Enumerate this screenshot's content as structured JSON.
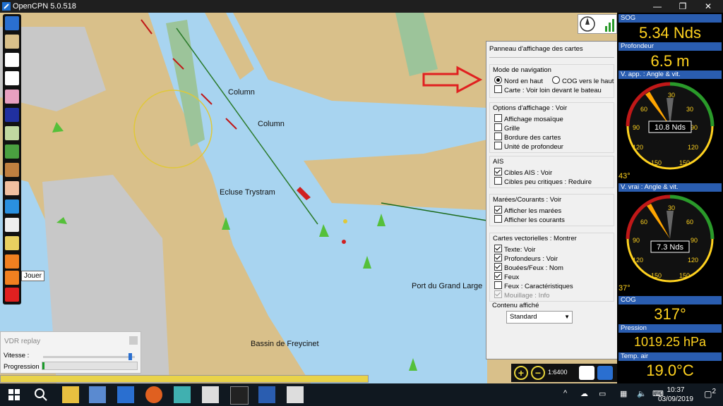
{
  "window": {
    "title": "OpenCPN 5.0.518",
    "minimize": "—",
    "maximize": "❐",
    "close": "✕"
  },
  "map": {
    "labels": {
      "column1": "Column",
      "column2": "Column",
      "ecluse": "Ecluse Trystram",
      "port": "Port du Grand Large",
      "bassin": "Bassin de Freycinet"
    }
  },
  "toolbar": {
    "tooltip": "Jouer",
    "icons": [
      "menu-icon",
      "settings-icon",
      "route-icon",
      "track-icon",
      "mark-icon",
      "chart-icon",
      "tides-icon",
      "grid-icon",
      "zoom-icon",
      "info-icon",
      "rocket-icon",
      "doc-icon",
      "pencil-icon",
      "record-icon",
      "play-icon",
      "lifebuoy-icon"
    ]
  },
  "panel": {
    "title": "Panneau d'affichage des cartes",
    "nav_mode": {
      "heading": "Mode de navigation",
      "north_up": "Nord en haut",
      "cog_up": "COG vers le haut",
      "look_ahead": "Carte : Voir loin devant le bateau"
    },
    "display": {
      "heading": "Options d'affichage : Voir",
      "mosaic": "Affichage mosaïque",
      "grid": "Grille",
      "borders": "Bordure des cartes",
      "depth_unit": "Unité de profondeur"
    },
    "ais": {
      "heading": "AIS",
      "targets": "Cibles AIS : Voir",
      "low_critical": "Cibles peu critiques : Reduire"
    },
    "tides": {
      "heading": "Marées/Courants : Voir",
      "show_tides": "Afficher les marées",
      "show_currents": "Afficher les courants"
    },
    "vector": {
      "heading": "Cartes vectorielles : Montrer",
      "text": "Texte: Voir",
      "soundings": "Profondeurs : Voir",
      "buoys": "Bouées/Feux : Nom",
      "lights": "Feux",
      "light_desc": "Feux : Caractéristiques",
      "anchorage": "Mouillage : Info"
    },
    "content": {
      "heading": "Contenu affiché",
      "selected": "Standard"
    }
  },
  "dashboard": {
    "sog": {
      "label": "SOG",
      "value": "5.34 Nds"
    },
    "depth": {
      "label": "Profondeur",
      "value": "6.5 m"
    },
    "apparent_wind": {
      "label": "V. app. : Angle & vit.",
      "speed": "10.8 Nds",
      "angle": "43°",
      "angle_deg": 43
    },
    "true_wind": {
      "label": "V. vrai : Angle & vit.",
      "speed": "7.3 Nds",
      "angle": "37°",
      "angle_deg": 37
    },
    "gauge_ticks": [
      "30",
      "60",
      "90",
      "120",
      "150",
      "30",
      "60",
      "90",
      "120",
      "150"
    ],
    "cog": {
      "label": "COG",
      "value": "317°"
    },
    "pressure": {
      "label": "Pression",
      "value": "1019.25 hPa"
    },
    "air_temp": {
      "label": "Temp. air",
      "value": "19.0°C"
    }
  },
  "vdr": {
    "title": "VDR replay",
    "speed_label": "Vitesse :",
    "progress_label": "Progression :",
    "speed_fraction": 0.97,
    "progress_fraction": 0.02
  },
  "zoom": {
    "scale": "1:6400"
  },
  "taskbar": {
    "time": "10:37",
    "date": "03/09/2019",
    "notifications": "2"
  },
  "colors": {
    "dash_header": "#2a5db0",
    "dash_value": "#ffd21f",
    "water": "#a8d4f0",
    "land": "#d9c08a"
  }
}
